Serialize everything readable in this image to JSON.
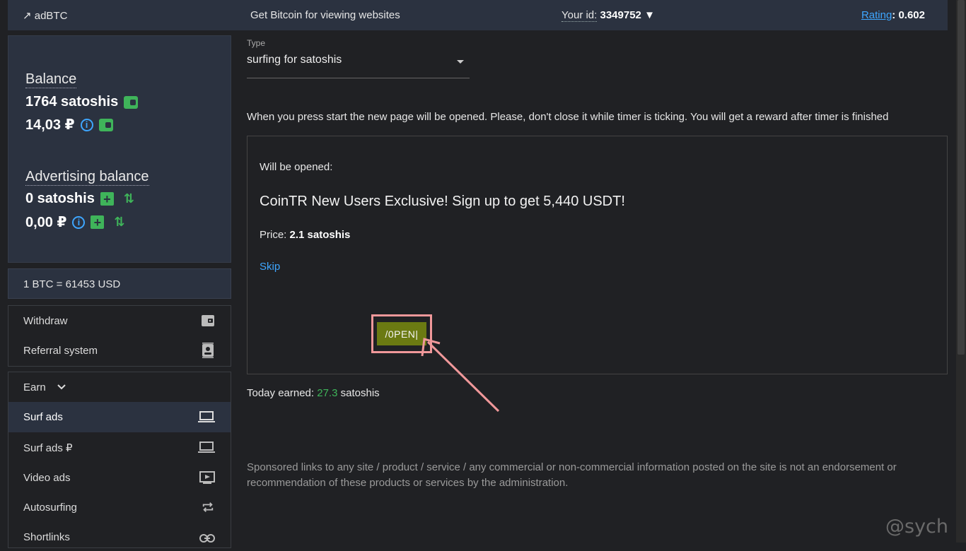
{
  "topbar": {
    "logo": "↗ adBTC",
    "tagline": "Get Bitcoin for viewing websites",
    "id_label": "Your id:",
    "id_value": "3349752 ▼",
    "rating_label": "Rating",
    "rating_value": ": 0.602"
  },
  "balance": {
    "title": "Balance",
    "satoshis": "1764 satoshis",
    "rub": "14,03 ₽",
    "ad_title": "Advertising balance",
    "ad_satoshis": "0 satoshis",
    "ad_rub": "0,00 ₽"
  },
  "rate": "1 BTC = 61453 USD",
  "menu_top": [
    {
      "label": "Withdraw",
      "icon": "wallet-icon"
    },
    {
      "label": "Referral system",
      "icon": "contact-icon"
    }
  ],
  "earn": {
    "label": "Earn",
    "items": [
      {
        "label": "Surf ads",
        "icon": "laptop-icon",
        "active": true
      },
      {
        "label": "Surf ads ₽",
        "icon": "laptop-icon",
        "active": false
      },
      {
        "label": "Video ads",
        "icon": "video-icon",
        "active": false
      },
      {
        "label": "Autosurfing",
        "icon": "repeat-icon",
        "active": false
      },
      {
        "label": "Shortlinks",
        "icon": "link-icon",
        "active": false
      }
    ]
  },
  "type_select": {
    "label": "Type",
    "value": "surfing for satoshis"
  },
  "notice": "When you press start the new page will be opened. Please, don't close it while timer is ticking. You will get a reward after timer is finished",
  "panel": {
    "will_be_opened": "Will be opened:",
    "title": "CoinTR New Users Exclusive! Sign up to get 5,440 USDT!",
    "price_label": "Price:",
    "price_value": "2.1 satoshis",
    "skip": "Skip",
    "open_button": "/0PEN|"
  },
  "earned": {
    "label": "Today earned:",
    "value": "27.3",
    "unit": "satoshis"
  },
  "disclaimer": "Sponsored links to any site / product / service / any commercial or non-commercial information posted on the site is not an endorsement or recommendation of these products or services by the administration.",
  "watermark": "@sych",
  "colors": {
    "accent_green": "#3fb45a",
    "link_blue": "#3ea6ff",
    "button_olive": "#6b7a12",
    "highlight_pink": "#f0989a"
  }
}
